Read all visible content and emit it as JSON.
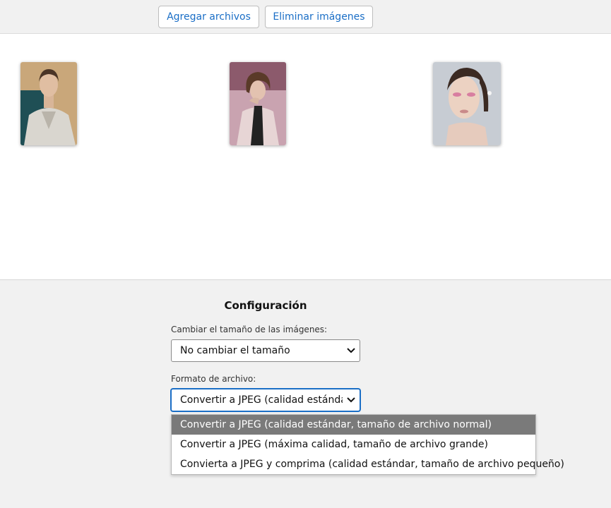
{
  "toolbar": {
    "add_label": "Agregar archivos",
    "delete_label": "Eliminar imágenes"
  },
  "gallery": {
    "images": [
      {
        "name": "photo-woman-trench-coat"
      },
      {
        "name": "photo-woman-curly-hair-scarf"
      },
      {
        "name": "photo-woman-pink-makeup"
      }
    ]
  },
  "config": {
    "title": "Configuración",
    "resize_label": "Cambiar el tamaño de las imágenes:",
    "resize_value": "No cambiar el tamaño",
    "format_label": "Formato de archivo:",
    "format_value": "Convertir a JPEG (calidad estándar, tamaño de archivo normal)",
    "format_options": [
      "Convertir a JPEG (calidad estándar, tamaño de archivo normal)",
      "Convertir a JPEG (máxima calidad, tamaño de archivo grande)",
      "Convierta a JPEG y comprima (calidad estándar, tamaño de archivo pequeño)"
    ],
    "selected_option_index": 0
  },
  "colors": {
    "accent": "#1a6ec6",
    "option_selected_bg": "#7a7a7a",
    "toolbar_bg": "#f1f1f1"
  }
}
